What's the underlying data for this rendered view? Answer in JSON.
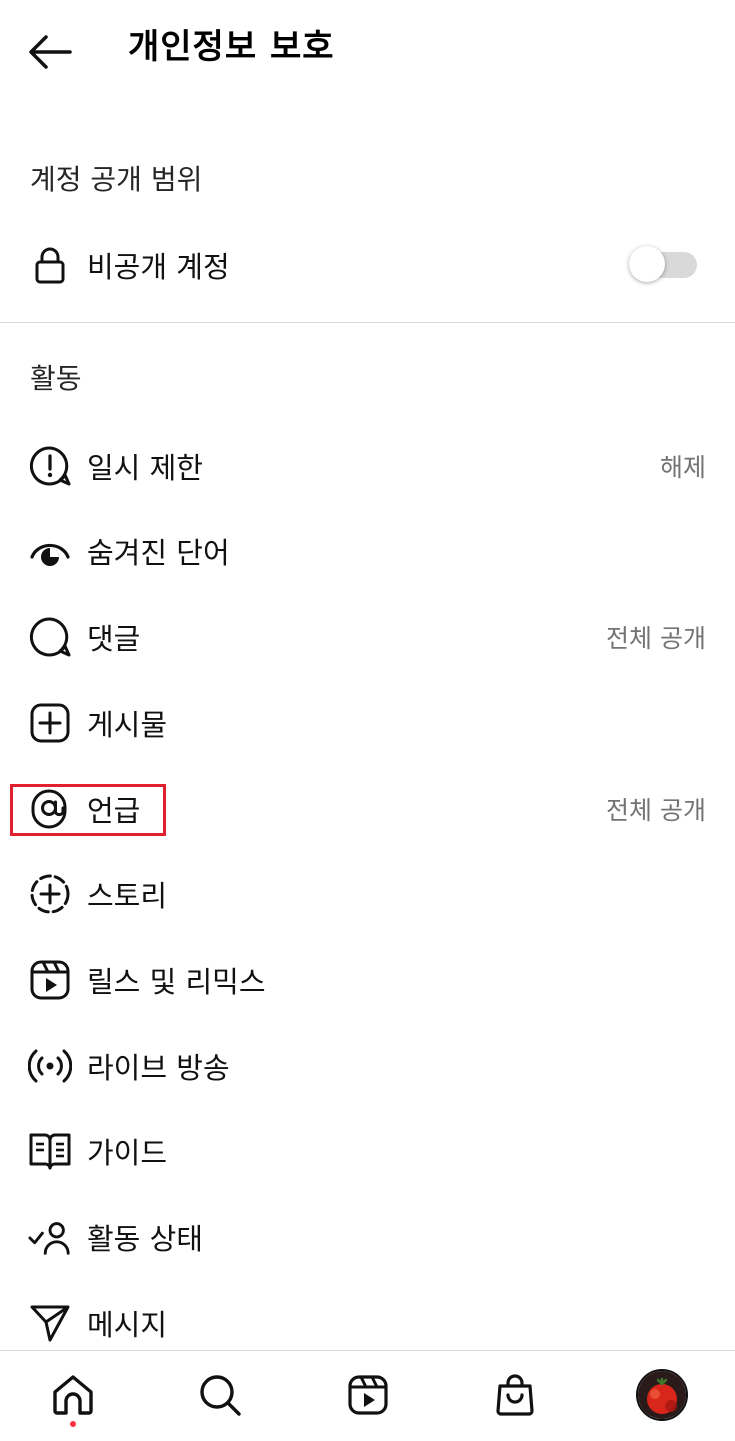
{
  "header": {
    "title": "개인정보 보호",
    "back_icon": "arrow-left-icon"
  },
  "account_privacy": {
    "section_title": "계정 공개 범위",
    "private_account": {
      "label": "비공개 계정",
      "icon": "lock-icon",
      "toggle_on": false
    }
  },
  "activity": {
    "section_title": "활동",
    "items": [
      {
        "label": "일시 제한",
        "value": "해제",
        "icon": "alert-circle-icon"
      },
      {
        "label": "숨겨진 단어",
        "value": "",
        "icon": "eye-hidden-icon"
      },
      {
        "label": "댓글",
        "value": "전체 공개",
        "icon": "comment-icon"
      },
      {
        "label": "게시물",
        "value": "",
        "icon": "plus-square-icon"
      },
      {
        "label": "언급",
        "value": "전체 공개",
        "icon": "at-sign-icon"
      },
      {
        "label": "스토리",
        "value": "",
        "icon": "story-add-icon"
      },
      {
        "label": "릴스 및 리믹스",
        "value": "",
        "icon": "reels-icon"
      },
      {
        "label": "라이브 방송",
        "value": "",
        "icon": "live-broadcast-icon"
      },
      {
        "label": "가이드",
        "value": "",
        "icon": "guide-book-icon"
      },
      {
        "label": "활동 상태",
        "value": "",
        "icon": "activity-status-icon"
      },
      {
        "label": "메시지",
        "value": "",
        "icon": "send-icon"
      }
    ]
  },
  "highlighted_item": "언급",
  "colors": {
    "highlight_box": "#e0202e",
    "notification_dot": "#ff3040",
    "secondary_text": "#737373"
  },
  "bottom_nav": {
    "items": [
      "home-icon",
      "search-icon",
      "reels-icon",
      "shop-icon",
      "profile-avatar"
    ],
    "active": "home-icon"
  }
}
